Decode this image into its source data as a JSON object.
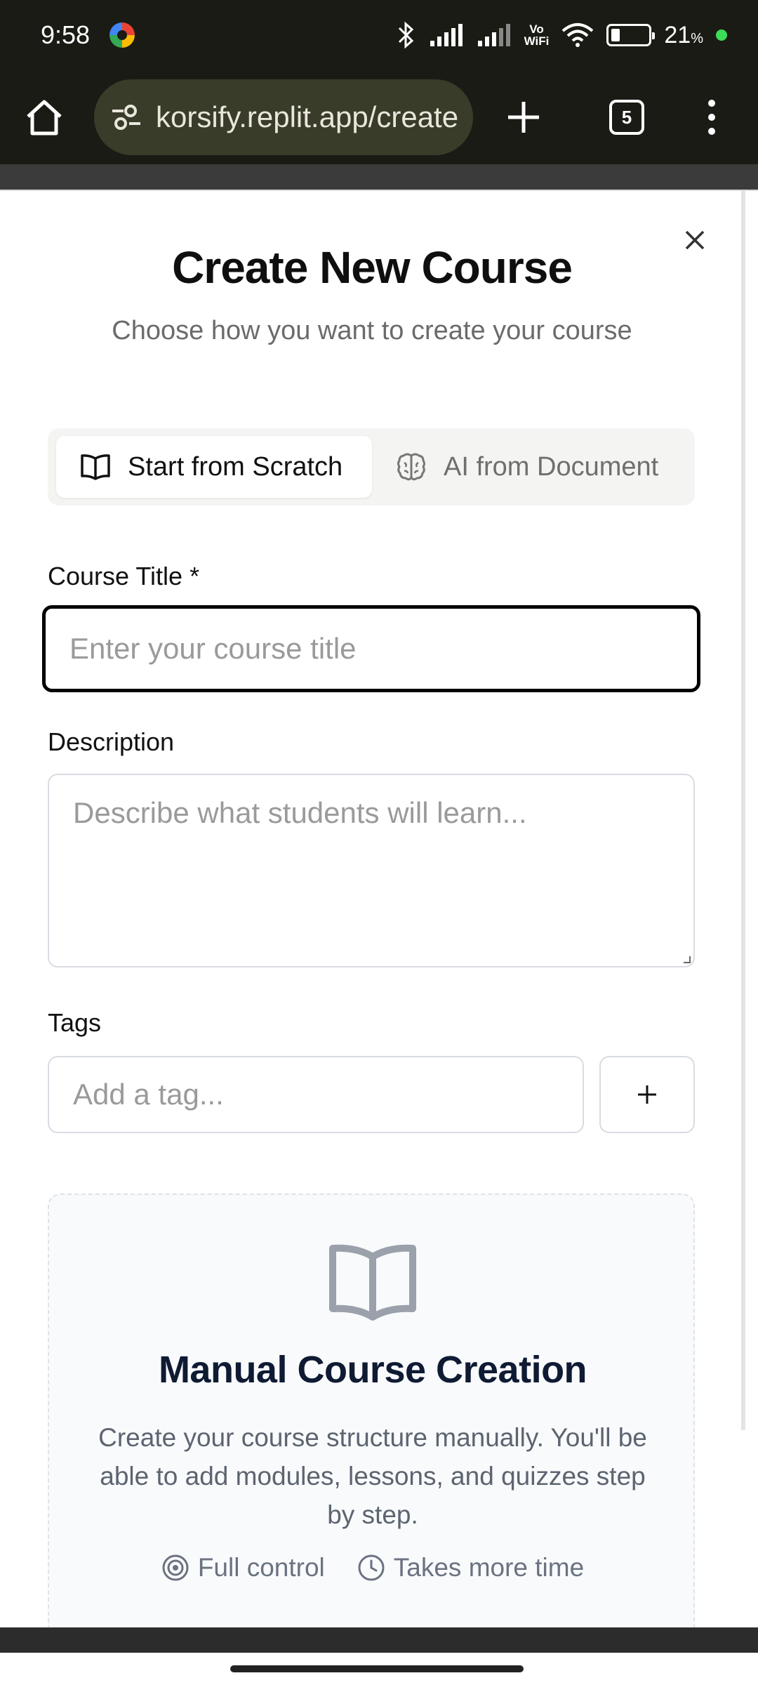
{
  "status_bar": {
    "time": "9:58",
    "battery": "21",
    "battery_unit": "%",
    "volte": "Vo\nWiFi"
  },
  "browser": {
    "url": "korsify.replit.app/create",
    "tab_count": "5"
  },
  "modal": {
    "title": "Create New Course",
    "subtitle": "Choose how you want to create your course",
    "tabs": [
      {
        "label": "Start from Scratch",
        "active": true
      },
      {
        "label": "AI from Document",
        "active": false
      }
    ],
    "course_title": {
      "label": "Course Title *",
      "placeholder": "Enter your course title",
      "value": ""
    },
    "description": {
      "label": "Description",
      "placeholder": "Describe what students will learn...",
      "value": ""
    },
    "tags": {
      "label": "Tags",
      "placeholder": "Add a tag...",
      "add_label": "+"
    },
    "manual_card": {
      "title": "Manual Course Creation",
      "description": "Create your course structure manually. You'll be able to add modules, lessons, and quizzes step by step.",
      "features": [
        "Full control",
        "Takes more time"
      ]
    }
  },
  "icons": {
    "home": "home-icon",
    "site_settings": "tune-icon",
    "new_tab": "plus-icon",
    "tabs": "tab-switcher-icon",
    "menu": "kebab-menu-icon",
    "close": "close-icon",
    "scratch": "book-open-icon",
    "ai": "brain-icon",
    "target": "target-icon",
    "clock": "clock-icon"
  }
}
